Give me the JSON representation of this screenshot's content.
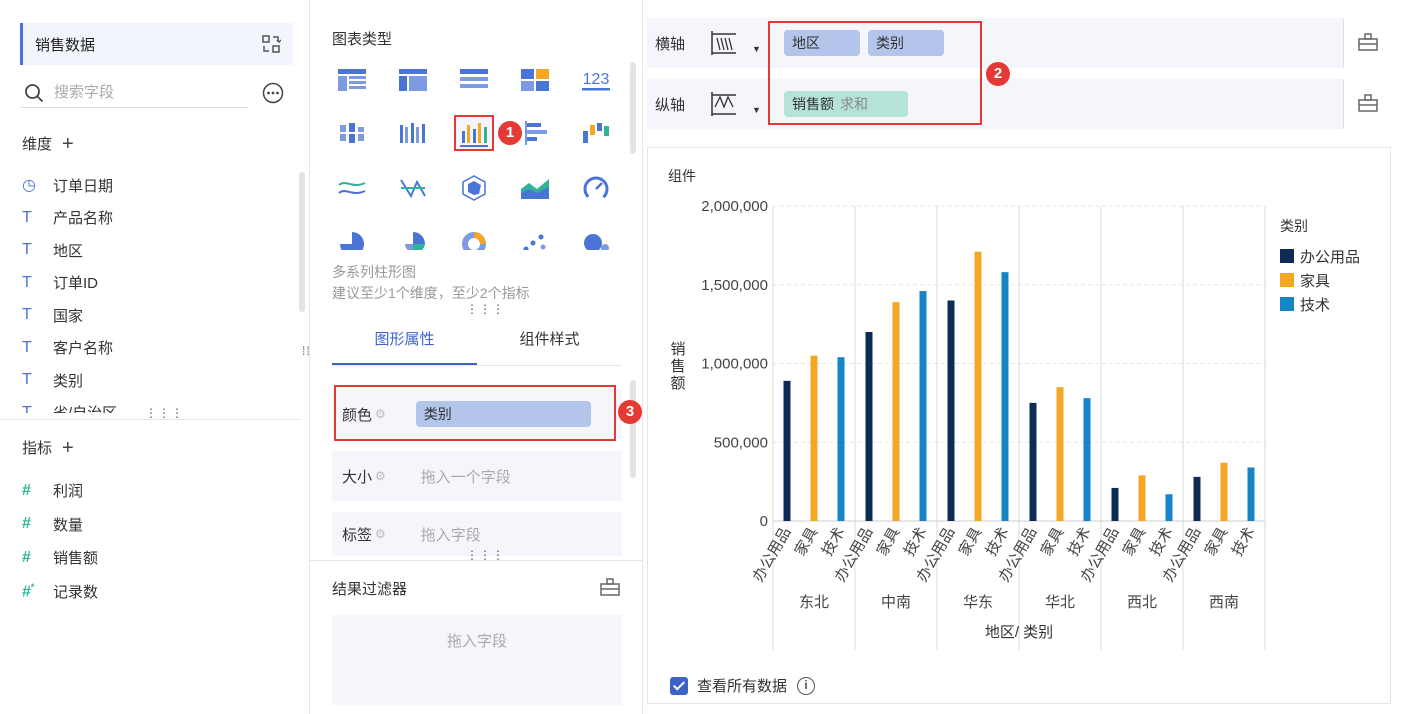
{
  "data_panel": {
    "dataset_title": "销售数据",
    "search_placeholder": "搜索字段",
    "dimensions_title": "维度",
    "dimensions": [
      {
        "label": "订单日期",
        "type": "date"
      },
      {
        "label": "产品名称",
        "type": "text"
      },
      {
        "label": "地区",
        "type": "text"
      },
      {
        "label": "订单ID",
        "type": "text"
      },
      {
        "label": "国家",
        "type": "text"
      },
      {
        "label": "客户名称",
        "type": "text"
      },
      {
        "label": "类别",
        "type": "text"
      },
      {
        "label": "省/自治区",
        "type": "text"
      }
    ],
    "measures_title": "指标",
    "measures": [
      {
        "label": "利润",
        "type": "number"
      },
      {
        "label": "数量",
        "type": "number"
      },
      {
        "label": "销售额",
        "type": "number"
      },
      {
        "label": "记录数",
        "type": "count"
      }
    ]
  },
  "config_panel": {
    "chart_type_title": "图表类型",
    "selected_chart_name": "多系列柱形图",
    "selected_chart_hint": "建议至少1个维度，至少2个指标",
    "tabs": [
      "图形属性",
      "组件样式"
    ],
    "active_tab": 0,
    "properties": {
      "color_label": "颜色",
      "color_value": "类别",
      "size_label": "大小",
      "size_placeholder": "拖入一个字段",
      "label_label": "标签",
      "label_placeholder": "拖入字段"
    },
    "filter_title": "结果过滤器",
    "filter_placeholder": "拖入字段"
  },
  "badges": [
    "1",
    "2",
    "3"
  ],
  "axes": {
    "x_label": "横轴",
    "x_fields": [
      "地区",
      "类别"
    ],
    "y_label": "纵轴",
    "y_field": "销售额",
    "y_agg": "求和"
  },
  "chart_card": {
    "title": "组件",
    "view_all_label": "查看所有数据",
    "view_all_checked": true,
    "info_glyph": "i"
  },
  "chart_data": {
    "type": "bar",
    "xlabel": "地区/ 类别",
    "ylabel": "销售额",
    "ylim": [
      0,
      2000000
    ],
    "yticks": [
      "0",
      "500,000",
      "1,000,000",
      "1,500,000",
      "2,000,000"
    ],
    "legend_title": "类别",
    "legend_position": "right",
    "categories": [
      "东北",
      "中南",
      "华东",
      "华北",
      "西北",
      "西南"
    ],
    "sub_categories": [
      "办公用品",
      "家具",
      "技术"
    ],
    "series": [
      {
        "name": "办公用品",
        "color": "#0d2c54",
        "values": [
          890000,
          1200000,
          1400000,
          750000,
          210000,
          280000
        ]
      },
      {
        "name": "家具",
        "color": "#f5a623",
        "values": [
          1050000,
          1390000,
          1710000,
          850000,
          290000,
          370000
        ]
      },
      {
        "name": "技术",
        "color": "#1585c8",
        "values": [
          1040000,
          1460000,
          1580000,
          780000,
          170000,
          340000
        ]
      }
    ],
    "grid": true
  },
  "colors": {
    "accent": "#3d63c9",
    "highlight": "#e53935",
    "pill_blue": "#b3c5ea",
    "pill_green": "#b5e3d8"
  }
}
